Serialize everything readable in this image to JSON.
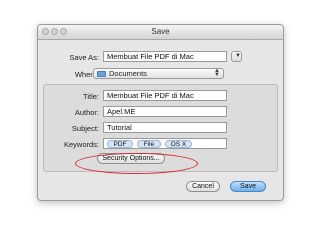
{
  "window": {
    "title": "Save"
  },
  "save_as": {
    "label": "Save As:",
    "value": "Membuat File PDF di Mac"
  },
  "where": {
    "label": "Where:",
    "value": "Documents"
  },
  "metadata": {
    "title_label": "Title:",
    "title_value": "Membuat File PDF di Mac",
    "author_label": "Author:",
    "author_value": "Apel.ME",
    "subject_label": "Subject:",
    "subject_value": "Tutorial",
    "keywords_label": "Keywords:",
    "keywords": [
      "PDF",
      "File",
      "OS X"
    ]
  },
  "security_button": "Security Options...",
  "cancel_button": "Cancel",
  "save_button": "Save",
  "colors": {
    "highlight_ellipse": "#d9262a",
    "default_button": "#6fb1ee"
  }
}
